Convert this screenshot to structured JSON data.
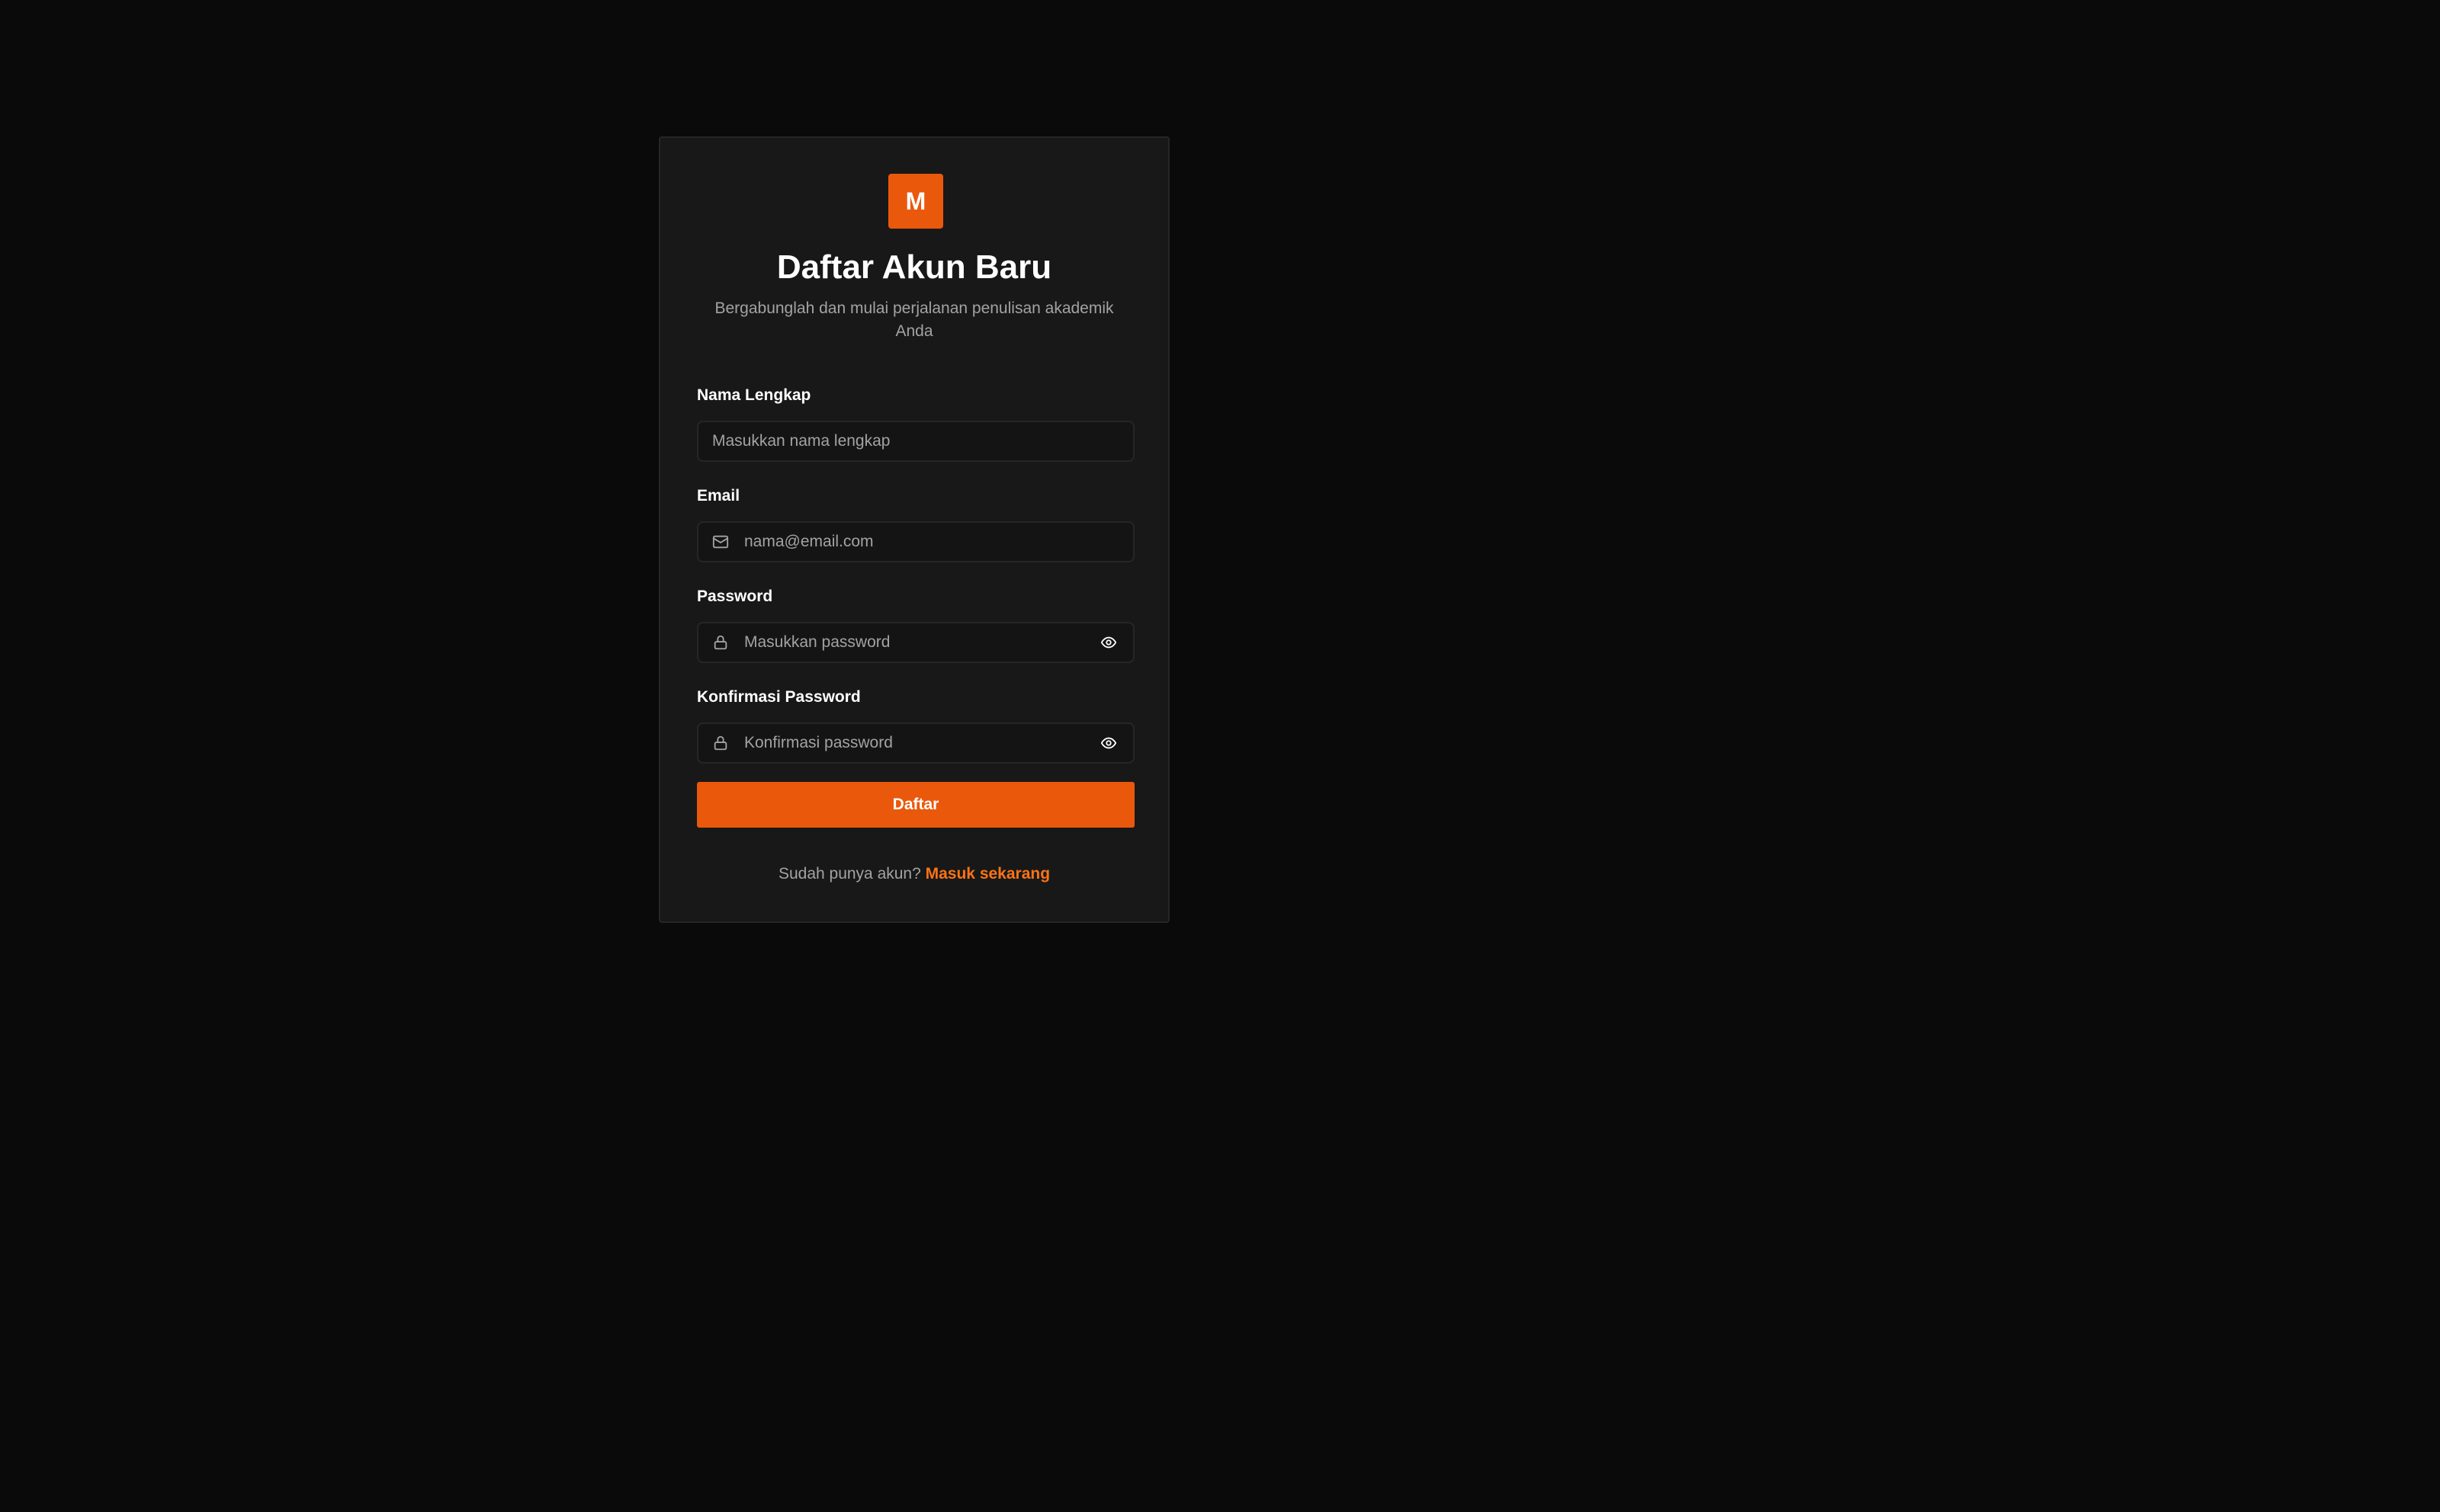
{
  "brand": {
    "logo_letter": "M",
    "accent": "#ea580c"
  },
  "header": {
    "title": "Daftar Akun Baru",
    "subtitle": "Bergabunglah dan mulai perjalanan penulisan akademik Anda"
  },
  "form": {
    "full_name": {
      "label": "Nama Lengkap",
      "placeholder": "Masukkan nama lengkap",
      "value": ""
    },
    "email": {
      "label": "Email",
      "placeholder": "nama@email.com",
      "value": "",
      "icon": "mail-icon"
    },
    "password": {
      "label": "Password",
      "placeholder": "Masukkan password",
      "value": "",
      "icon": "lock-icon",
      "toggle_icon": "eye-icon"
    },
    "confirm_password": {
      "label": "Konfirmasi Password",
      "placeholder": "Konfirmasi password",
      "value": "",
      "icon": "lock-icon",
      "toggle_icon": "eye-icon"
    },
    "submit_label": "Daftar"
  },
  "footer": {
    "prompt": "Sudah punya akun?",
    "link_label": "Masuk sekarang"
  }
}
